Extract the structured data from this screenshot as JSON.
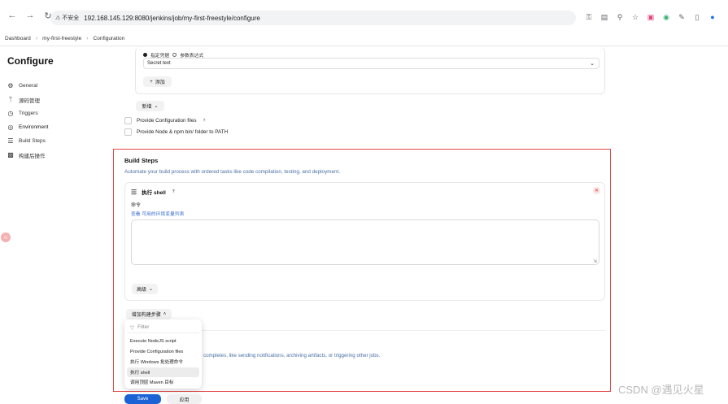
{
  "browser": {
    "insecure_label": "不安全",
    "url": "192.168.145.129:8080/jenkins/job/my-first-freestyle/configure"
  },
  "breadcrumb": [
    "Dashboard",
    "my-first-freestyle",
    "Configuration"
  ],
  "sidebar": {
    "title": "Configure",
    "items": [
      {
        "label": "General",
        "icon": "gear-icon"
      },
      {
        "label": "源码管理",
        "icon": "branch-icon"
      },
      {
        "label": "Triggers",
        "icon": "clock-icon"
      },
      {
        "label": "Environment",
        "icon": "globe-icon"
      },
      {
        "label": "Build Steps",
        "icon": "list-icon"
      },
      {
        "label": "构建后操作",
        "icon": "package-icon"
      }
    ]
  },
  "credentials": {
    "radio_specified": "指定凭据",
    "radio_param": "参数表达式",
    "selected": "Secret text",
    "add_label": "添加"
  },
  "env": {
    "new_label": "新增",
    "provide_config_files": "Provide Configuration files",
    "provide_node": "Provide Node & npm bin/ folder to PATH"
  },
  "build_steps": {
    "title": "Build Steps",
    "description": "Automate your build process with ordered tasks like code compilation, testing, and deployment.",
    "shell": {
      "title": "执行 shell",
      "command_label": "命令",
      "env_link": "查看 可用的环境变量列表",
      "command_value": "",
      "advanced_label": "高级"
    },
    "add_step_label": "增加构建步骤"
  },
  "dropdown": {
    "filter_placeholder": "Filter",
    "items": [
      "Execute NodeJS script",
      "Provide Configuration files",
      "执行 Windows 批处理命令",
      "执行 shell",
      "调用顶层 Maven 目标"
    ],
    "hovered_index": 3
  },
  "post_build_desc": "completes, like sending notifications, archiving artifacts, or triggering other jobs.",
  "actions": {
    "save": "Save",
    "apply": "应用"
  },
  "watermark": "CSDN @遇见火星"
}
